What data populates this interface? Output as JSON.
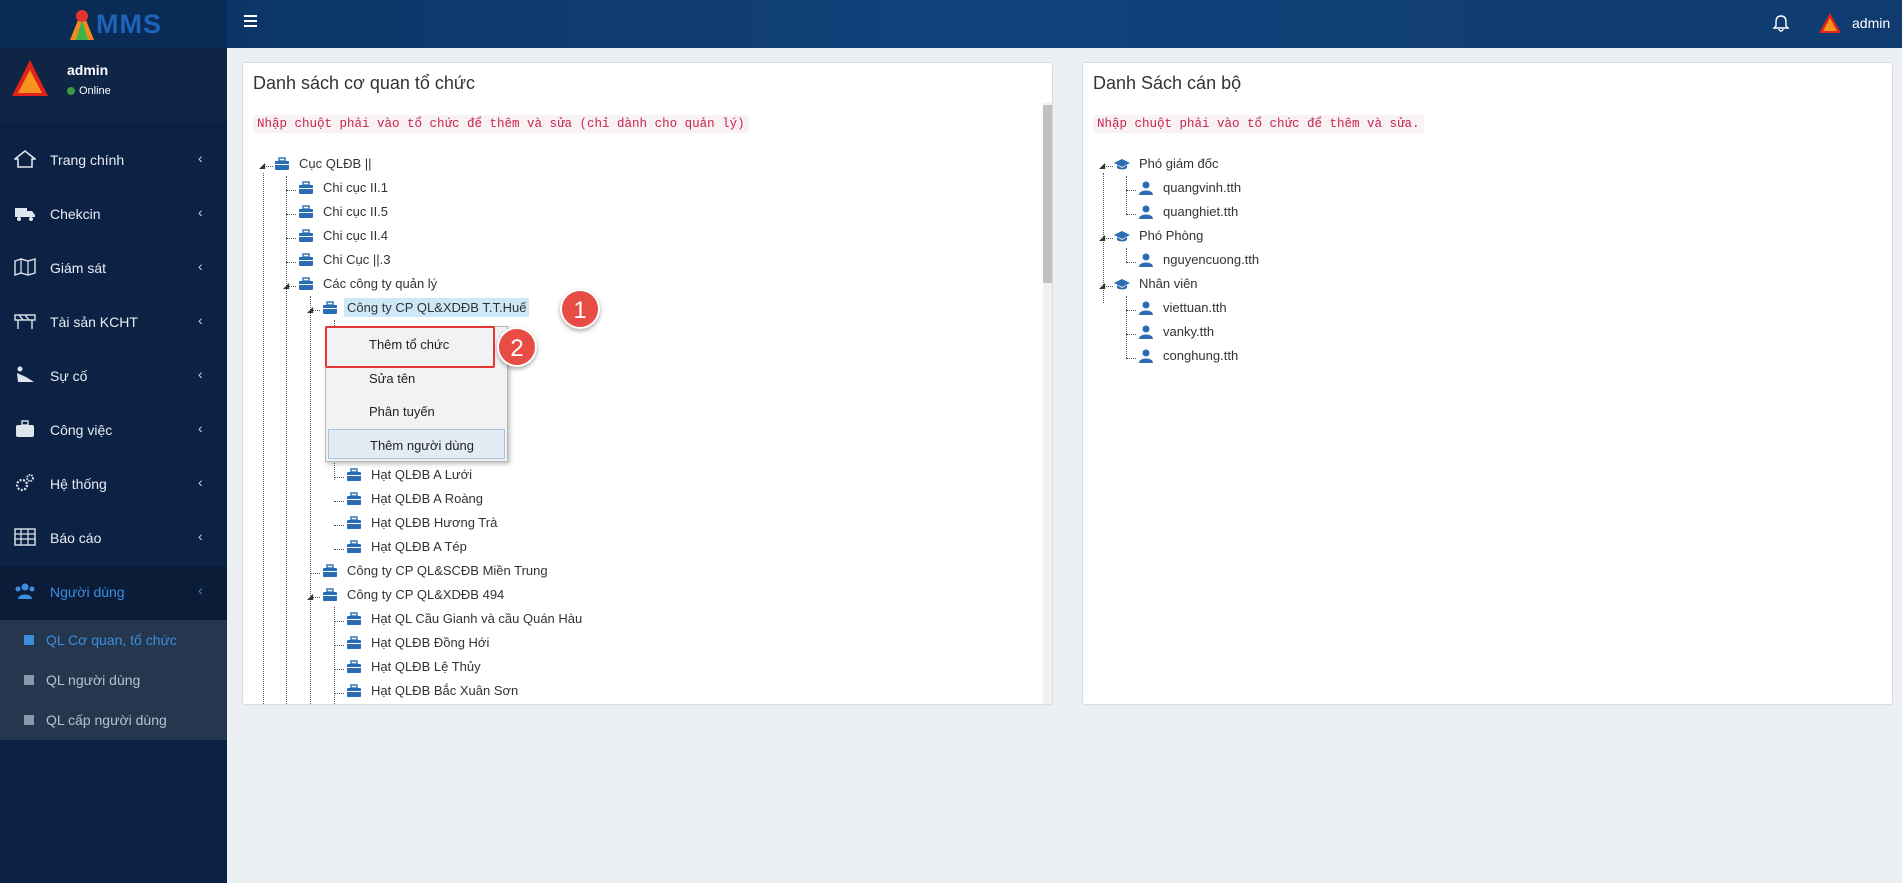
{
  "app": {
    "logo_text": "MMS",
    "brand_color": "#1d63b8"
  },
  "topbar": {
    "user_name": "admin"
  },
  "sidebar": {
    "user": {
      "name": "admin",
      "status": "Online"
    },
    "menu": [
      {
        "label": "Trang chính",
        "icon": "home-icon"
      },
      {
        "label": "Chekcin",
        "icon": "truck-icon"
      },
      {
        "label": "Giám sát",
        "icon": "map-icon"
      },
      {
        "label": "Tài sản KCHT",
        "icon": "road-barrier-icon"
      },
      {
        "label": "Sự cố",
        "icon": "accident-icon"
      },
      {
        "label": "Công việc",
        "icon": "briefcase-icon"
      },
      {
        "label": "Hệ thống",
        "icon": "gears-icon"
      },
      {
        "label": "Báo cáo",
        "icon": "table-icon"
      },
      {
        "label": "Người dùng",
        "icon": "users-icon",
        "active": true
      }
    ],
    "submenu": [
      {
        "label": "QL Cơ quan, tổ chức",
        "active": true
      },
      {
        "label": "QL người dùng"
      },
      {
        "label": "QL cấp người dùng"
      }
    ]
  },
  "left_panel": {
    "title": "Danh sách cơ quan tổ chức",
    "note": "Nhập chuột phải vào tổ chức để thêm và sửa (chỉ dành cho quản lý)",
    "tree": [
      "Cục QLĐB ||",
      "Chi cục II.1",
      "Chi cục II.5",
      "Chi cục II.4",
      "Chi Cục ||.3",
      "Các công ty quản lý",
      "Công ty CP QL&XDĐB T.T.Huế",
      "Hạt QLĐB A Lưới",
      "Hạt QLĐB A Roàng",
      "Hạt QLĐB Hương Trà",
      "Hạt QLĐB A Tép",
      "Công ty CP QL&SCĐB Miền Trung",
      "Công ty CP QL&XDĐB 494",
      "Hạt QL Cầu Gianh và cầu Quán Hàu",
      "Hạt QLĐB Đồng Hới",
      "Hạt QLĐB Lệ Thủy",
      "Hạt QLĐB Bắc Xuân Sơn"
    ]
  },
  "context_menu": {
    "items": [
      "Thêm tổ chức",
      "Sửa tên",
      "Phân tuyến",
      "Thêm người dùng"
    ]
  },
  "callouts": [
    "1",
    "2"
  ],
  "right_panel": {
    "title": "Danh Sách cán bộ",
    "note": "Nhập chuột phải vào tổ chức để thêm và sửa.",
    "tree": [
      "Phó giám đốc",
      "quangvinh.tth",
      "quanghiet.tth",
      "Phó Phòng",
      "nguyencuong.tth",
      "Nhân viên",
      "viettuan.tth",
      "vanky.tth",
      "conghung.tth"
    ]
  }
}
